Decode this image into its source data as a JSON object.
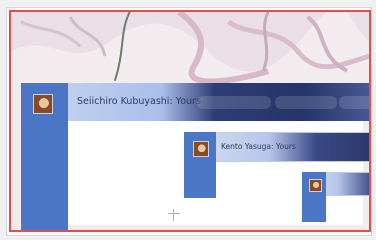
{
  "notifications": {
    "first": {
      "text": "Seiichiro Kubuyashi: Yours",
      "pills": [
        "",
        "",
        ""
      ]
    },
    "second": {
      "text": "Kento Yasuga: Yours"
    },
    "third": {
      "text": ""
    }
  },
  "colors": {
    "highlight_border": "#e44d4d",
    "sidebar_blue": "#4b76c5",
    "dark_navy": "#253468"
  },
  "icons": {
    "avatar": "user-avatar-icon"
  }
}
